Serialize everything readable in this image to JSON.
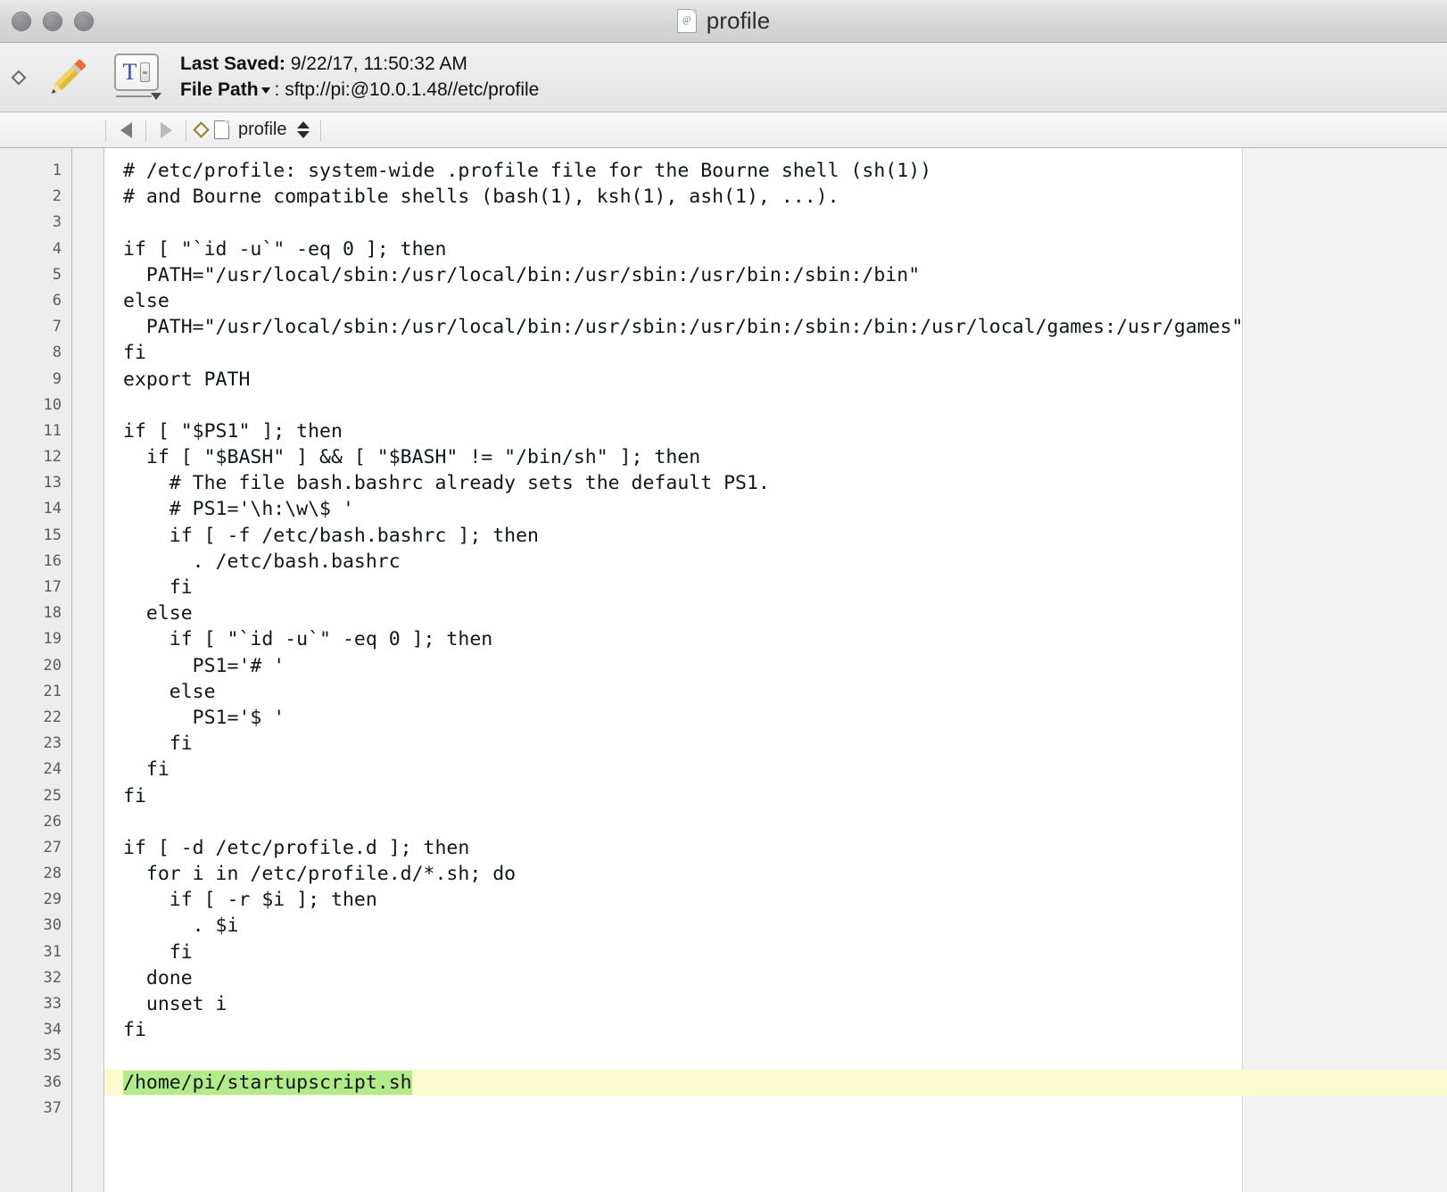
{
  "window": {
    "title": "profile",
    "title_icon": "document-icon",
    "traffic_lights": [
      "close-button",
      "minimize-button",
      "zoom-button"
    ]
  },
  "toolbar": {
    "mode_icon": "diamond-icon",
    "edit_icon": "pencil-icon",
    "text_format_icon": "text-format-icon",
    "text_format_glyph": "T",
    "last_saved_label": "Last Saved:",
    "last_saved_value": " 9/22/17, 11:50:32 AM",
    "file_path_label": "File Path",
    "file_path_separator": ": ",
    "file_path_value": "sftp://pi:@10.0.1.48//etc/profile"
  },
  "navbar": {
    "back_icon": "arrow-left-icon",
    "forward_icon": "arrow-right-icon",
    "marker_icon": "diamond-icon",
    "file_icon": "document-icon",
    "tab_name": "profile",
    "stepper_icon": "up-down-stepper-icon"
  },
  "editor": {
    "selection_color": "#b4eb8a",
    "line_highlight_color": "#fcfbd0",
    "gutter_color": "#ededed",
    "page_guide_color": "#f2f2f2",
    "line_numbers": [
      1,
      2,
      3,
      4,
      5,
      6,
      7,
      8,
      9,
      10,
      11,
      12,
      13,
      14,
      15,
      16,
      17,
      18,
      19,
      20,
      21,
      22,
      23,
      24,
      25,
      26,
      27,
      28,
      29,
      30,
      31,
      32,
      33,
      34,
      35,
      36,
      37
    ],
    "lines": [
      {
        "n": 1,
        "text": "# /etc/profile: system-wide .profile file for the Bourne shell (sh(1))"
      },
      {
        "n": 2,
        "text": "# and Bourne compatible shells (bash(1), ksh(1), ash(1), ...)."
      },
      {
        "n": 3,
        "text": ""
      },
      {
        "n": 4,
        "text": "if [ \"`id -u`\" -eq 0 ]; then"
      },
      {
        "n": 5,
        "text": "  PATH=\"/usr/local/sbin:/usr/local/bin:/usr/sbin:/usr/bin:/sbin:/bin\""
      },
      {
        "n": 6,
        "text": "else"
      },
      {
        "n": 7,
        "text": "  PATH=\"/usr/local/sbin:/usr/local/bin:/usr/sbin:/usr/bin:/sbin:/bin:/usr/local/games:/usr/games\""
      },
      {
        "n": 8,
        "text": "fi"
      },
      {
        "n": 9,
        "text": "export PATH"
      },
      {
        "n": 10,
        "text": ""
      },
      {
        "n": 11,
        "text": "if [ \"$PS1\" ]; then"
      },
      {
        "n": 12,
        "text": "  if [ \"$BASH\" ] && [ \"$BASH\" != \"/bin/sh\" ]; then"
      },
      {
        "n": 13,
        "text": "    # The file bash.bashrc already sets the default PS1."
      },
      {
        "n": 14,
        "text": "    # PS1='\\h:\\w\\$ '"
      },
      {
        "n": 15,
        "text": "    if [ -f /etc/bash.bashrc ]; then"
      },
      {
        "n": 16,
        "text": "      . /etc/bash.bashrc"
      },
      {
        "n": 17,
        "text": "    fi"
      },
      {
        "n": 18,
        "text": "  else"
      },
      {
        "n": 19,
        "text": "    if [ \"`id -u`\" -eq 0 ]; then"
      },
      {
        "n": 20,
        "text": "      PS1='# '"
      },
      {
        "n": 21,
        "text": "    else"
      },
      {
        "n": 22,
        "text": "      PS1='$ '"
      },
      {
        "n": 23,
        "text": "    fi"
      },
      {
        "n": 24,
        "text": "  fi"
      },
      {
        "n": 25,
        "text": "fi"
      },
      {
        "n": 26,
        "text": ""
      },
      {
        "n": 27,
        "text": "if [ -d /etc/profile.d ]; then"
      },
      {
        "n": 28,
        "text": "  for i in /etc/profile.d/*.sh; do"
      },
      {
        "n": 29,
        "text": "    if [ -r $i ]; then"
      },
      {
        "n": 30,
        "text": "      . $i"
      },
      {
        "n": 31,
        "text": "    fi"
      },
      {
        "n": 32,
        "text": "  done"
      },
      {
        "n": 33,
        "text": "  unset i"
      },
      {
        "n": 34,
        "text": "fi"
      },
      {
        "n": 35,
        "text": ""
      },
      {
        "n": 36,
        "text": "/home/pi/startupscript.sh",
        "selected": true,
        "highlighted": true
      },
      {
        "n": 37,
        "text": ""
      }
    ]
  }
}
